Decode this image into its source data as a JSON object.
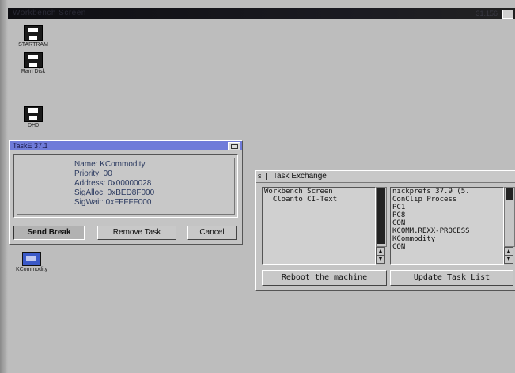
{
  "screen": {
    "title": "Workbench Screen",
    "version": "31.156"
  },
  "icons": [
    {
      "id": "startram",
      "label": "STARTRAM"
    },
    {
      "id": "ramdisk",
      "label": "Ram Disk"
    },
    {
      "id": "dh0",
      "label": "DH0"
    },
    {
      "id": "kcommodity",
      "label": "KCommodity"
    }
  ],
  "taske": {
    "title": "TaskE 37.1",
    "info": {
      "name": "Name: KCommodity",
      "priority": "Priority: 00",
      "address": "Address: 0x00000028",
      "sigalloc": "SigAlloc: 0xBED8F000",
      "sigwait": "SigWait: 0xFFFFF000"
    },
    "buttons": {
      "send_break": "Send Break",
      "remove_task": "Remove Task",
      "cancel": "Cancel"
    }
  },
  "task_exchange": {
    "title": "Task Exchange",
    "close_label": "s",
    "screens": [
      "Workbench Screen",
      "  Cloanto CI-Text"
    ],
    "tasks": [
      "nickprefs 37.9 (5.",
      "ConClip Process",
      "PC1",
      "PC8",
      "CON",
      "KCOMM.REXX-PROCESS",
      "KCommodity",
      "CON"
    ],
    "buttons": {
      "reboot": "Reboot the machine",
      "update": "Update Task List"
    }
  },
  "colors": {
    "desktop": "#bdbdbd",
    "active_title": "#6f7bd9"
  }
}
